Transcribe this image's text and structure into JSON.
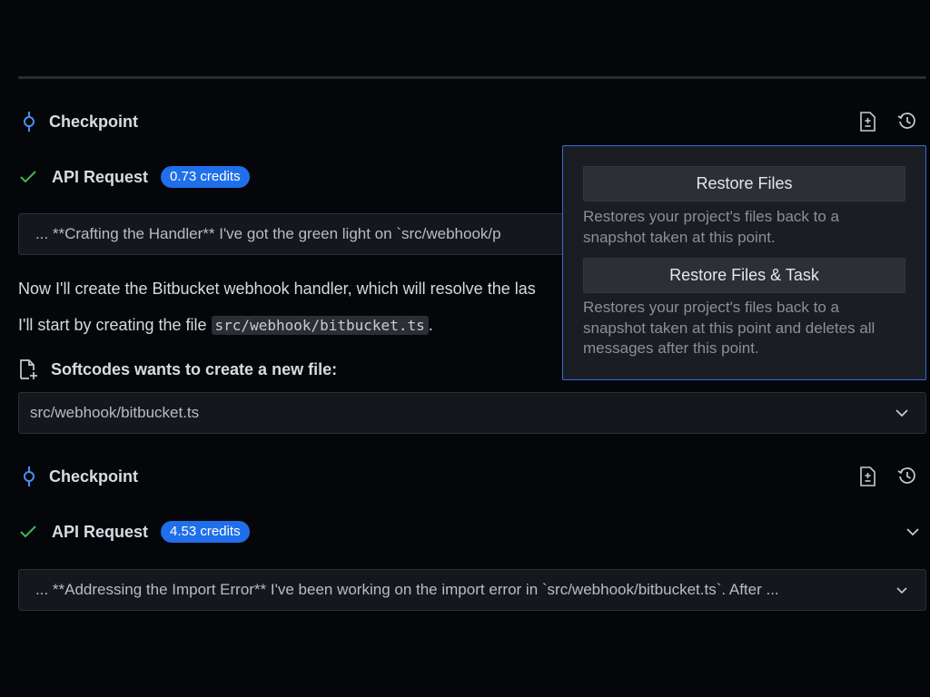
{
  "checkpoint1": {
    "label": "Checkpoint"
  },
  "api1": {
    "label": "API Request",
    "credits": "0.73 credits"
  },
  "thinking1": {
    "text": "... **Crafting the Handler** I've got the green light on `src/webhook/p"
  },
  "message": {
    "line1": "Now I'll create the Bitbucket webhook handler, which will resolve the las",
    "line2_prefix": "I'll start by creating the file ",
    "line2_code": "src/webhook/bitbucket.ts",
    "line2_suffix": "."
  },
  "newfile": {
    "label": "Softcodes wants to create a new file:",
    "path": "src/webhook/bitbucket.ts"
  },
  "checkpoint2": {
    "label": "Checkpoint"
  },
  "api2": {
    "label": "API Request",
    "credits": "4.53 credits"
  },
  "thinking2": {
    "text": "... **Addressing the Import Error** I've been working on the import error in `src/webhook/bitbucket.ts`. After ..."
  },
  "popover": {
    "restore_files_label": "Restore Files",
    "restore_files_desc": "Restores your project's files back to a snapshot taken at this point.",
    "restore_task_label": "Restore Files & Task",
    "restore_task_desc": "Restores your project's files back to a snapshot taken at this point and deletes all messages after this point."
  },
  "colors": {
    "accent": "#1f6feb",
    "success": "#3fb950",
    "popover_border": "#2f6fd6"
  },
  "icons": [
    "git-commit-icon",
    "file-diff-icon",
    "history-icon",
    "check-icon",
    "file-plus-icon",
    "chevron-down-icon"
  ]
}
